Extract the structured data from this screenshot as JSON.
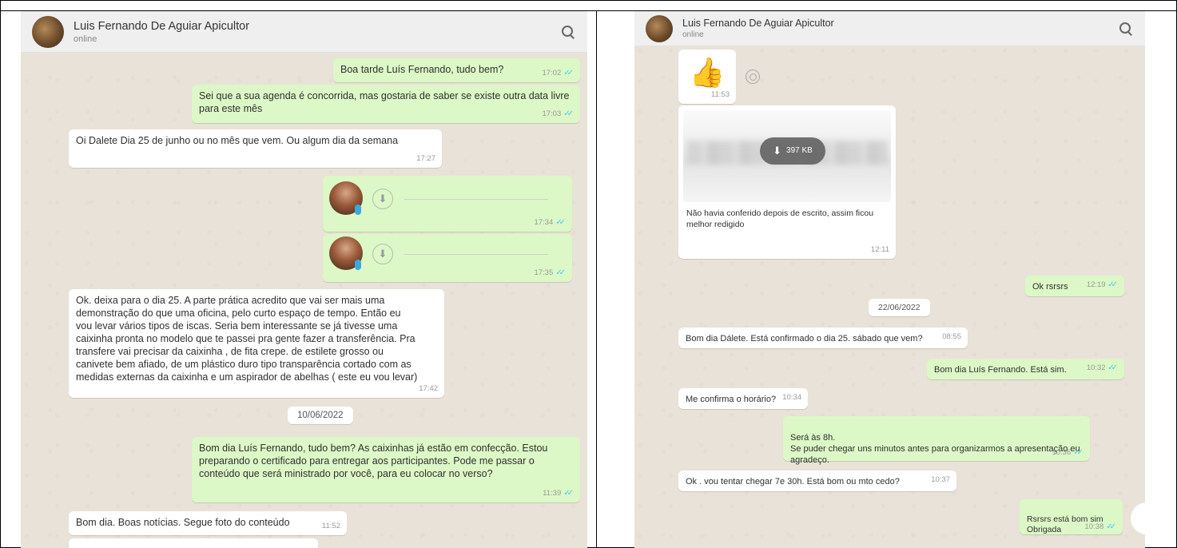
{
  "left": {
    "header": {
      "name": "Luis Fernando De Aguiar Apicultor",
      "status": "online"
    },
    "messages": [
      {
        "text": "Boa tarde Luís Fernando, tudo bem?",
        "time": "17:02"
      },
      {
        "text": "Sei que a sua agenda é concorrida, mas gostaria de saber se existe outra data livre para este mês",
        "time": "17:03"
      },
      {
        "text": "Oi Dalete Dia 25 de junho ou no mês que vem. Ou algum dia da semana",
        "time": "17:27"
      },
      {
        "time": "17:34"
      },
      {
        "time": "17:35"
      },
      {
        "text": "Ok. deixa para o dia 25. A parte prática acredito que vai ser mais uma demonstração do que uma oficina, pelo curto espaço de tempo. Então eu vou levar vários tipos de iscas. Seria bem interessante se já tivesse uma caixinha pronta no modelo que te passei pra gente fazer a transferência. Pra transfere vai precisar da caixinha , de fita crepe. de estilete grosso ou canivete bem afiado, de um plástico duro tipo transparência cortado com as medidas externas da caixinha e um aspirador de abelhas ( este eu vou levar)",
        "time": "17:42"
      },
      {
        "date": "10/06/2022"
      },
      {
        "text": "Bom dia Luís Fernando, tudo bem?  As caixinhas já estão em confecção. Estou preparando o certificado para entregar aos participantes. Pode me passar o conteúdo que será ministrado por você, para eu colocar no verso?",
        "time": "11:39"
      },
      {
        "text": "Bom dia. Boas notícias. Segue foto  do conteúdo",
        "time": "11:52"
      }
    ]
  },
  "right": {
    "header": {
      "name": "Luis Fernando De Aguiar Apicultor",
      "status": "online"
    },
    "messages": [
      {
        "emoji": "👍",
        "time": "11:53"
      },
      {
        "size": "397 KB",
        "caption": "Não havia conferido depois de escrito, assim ficou melhor redigido",
        "time": "12:11"
      },
      {
        "text": "Ok rsrsrs",
        "time": "12:19"
      },
      {
        "date": "22/06/2022"
      },
      {
        "text": "Bom dia Dálete. Está confirmado o dia 25. sábado que vem?",
        "time": "08:55"
      },
      {
        "text": "Bom dia Luís Fernando. Está sim.",
        "time": "10:32"
      },
      {
        "text": "Me confirma o horário?",
        "time": "10:34"
      },
      {
        "text": "Será às 8h.\nSe puder chegar uns minutos antes para organizarmos a apresentação eu agradeço.",
        "time": "10:36"
      },
      {
        "text": "Ok . vou tentar chegar 7e 30h. Está bom ou mto cedo?",
        "time": "10:37"
      },
      {
        "text": "Rsrsrs está bom sim\nObrigada",
        "time": "10:38"
      }
    ]
  }
}
